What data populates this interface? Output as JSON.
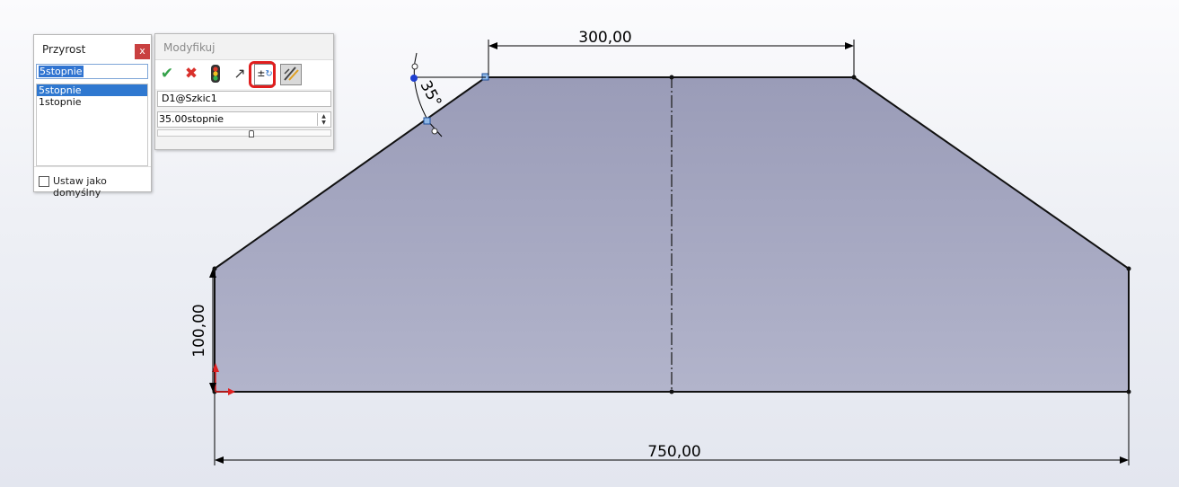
{
  "dimensions": {
    "top_width": "300,00",
    "bottom_width": "750,00",
    "left_height": "100,00",
    "angle": "35°"
  },
  "przyrost_panel": {
    "title": "Przyrost",
    "close_label": "x",
    "input_value": "5stopnie",
    "list_items": [
      "5stopnie",
      "1stopnie"
    ],
    "selected_index": 0,
    "checkbox_label": "Ustaw jako domyślny",
    "checkbox_checked": false
  },
  "modify_panel": {
    "title": "Modyfikuj",
    "dimension_name": "D1@Szkic1",
    "value": "35.00stopnie",
    "increment_button_label": "±",
    "icons": [
      "checkmark-icon",
      "cancel-icon",
      "rebuild-icon",
      "arrow-icon",
      "increment-icon",
      "mark-dimension-icon"
    ]
  },
  "colors": {
    "sketch_fill_top": "#9a9cb8",
    "sketch_fill_bottom": "#b2b4cb",
    "highlight": "#e01e1e",
    "ok": "#35a24a",
    "cancel": "#d9302b"
  }
}
